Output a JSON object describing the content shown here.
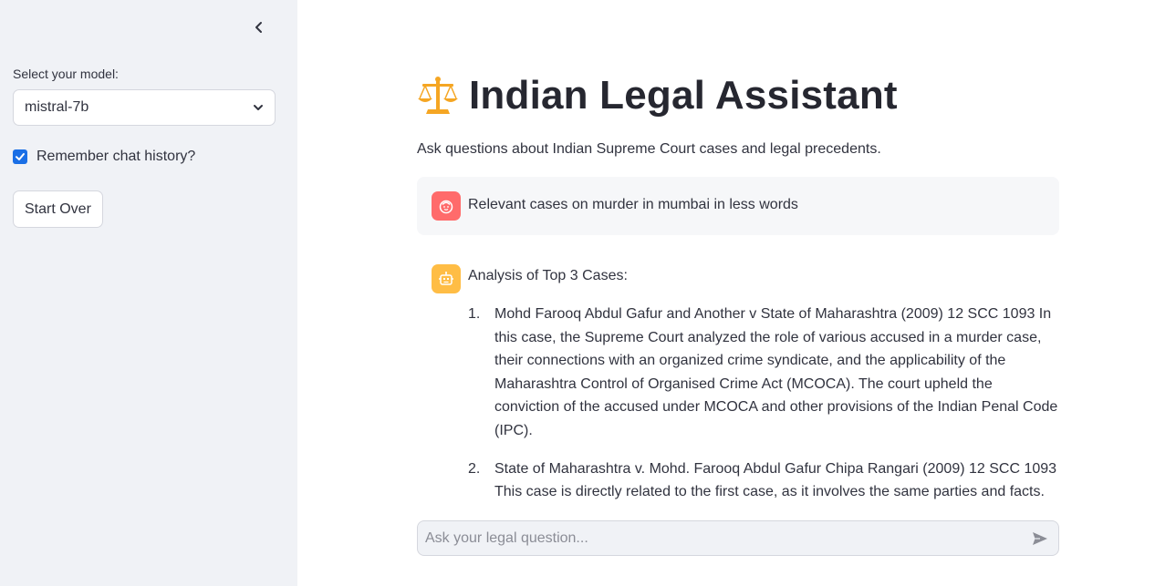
{
  "sidebar": {
    "collapse_icon": "chevron-left-icon",
    "model_label": "Select your model:",
    "model_value": "mistral-7b",
    "remember_label": "Remember chat history?",
    "remember_checked": true,
    "start_over_label": "Start Over"
  },
  "main": {
    "title": "Indian Legal Assistant",
    "title_icon": "balance-scale-icon",
    "subtitle": "Ask questions about Indian Supreme Court cases and legal precedents.",
    "user_message": "Relevant cases on murder in mumbai in less words",
    "assistant_intro": "Analysis of Top 3 Cases:",
    "cases": [
      {
        "num": "1.",
        "text": "Mohd Farooq Abdul Gafur and Another v State of Maharashtra (2009) 12 SCC 1093 In this case, the Supreme Court analyzed the role of various accused in a murder case, their connections with an organized crime syndicate, and the applicability of the Maharashtra Control of Organised Crime Act (MCOCA). The court upheld the conviction of the accused under MCOCA and other provisions of the Indian Penal Code (IPC)."
      },
      {
        "num": "2.",
        "text": "State of Maharashtra v. Mohd. Farooq Abdul Gafur Chipa Rangari (2009) 12 SCC 1093 This case is directly related to the first case, as it involves the same parties and facts."
      }
    ],
    "input_placeholder": "Ask your legal question...",
    "send_icon": "send-icon"
  },
  "colors": {
    "sidebar_bg": "#f0f2f6",
    "checkbox": "#1a6fe6",
    "user_avatar": "#ff6b6b",
    "bot_avatar": "#ffbd45",
    "scale_icon": "#f5a623"
  }
}
